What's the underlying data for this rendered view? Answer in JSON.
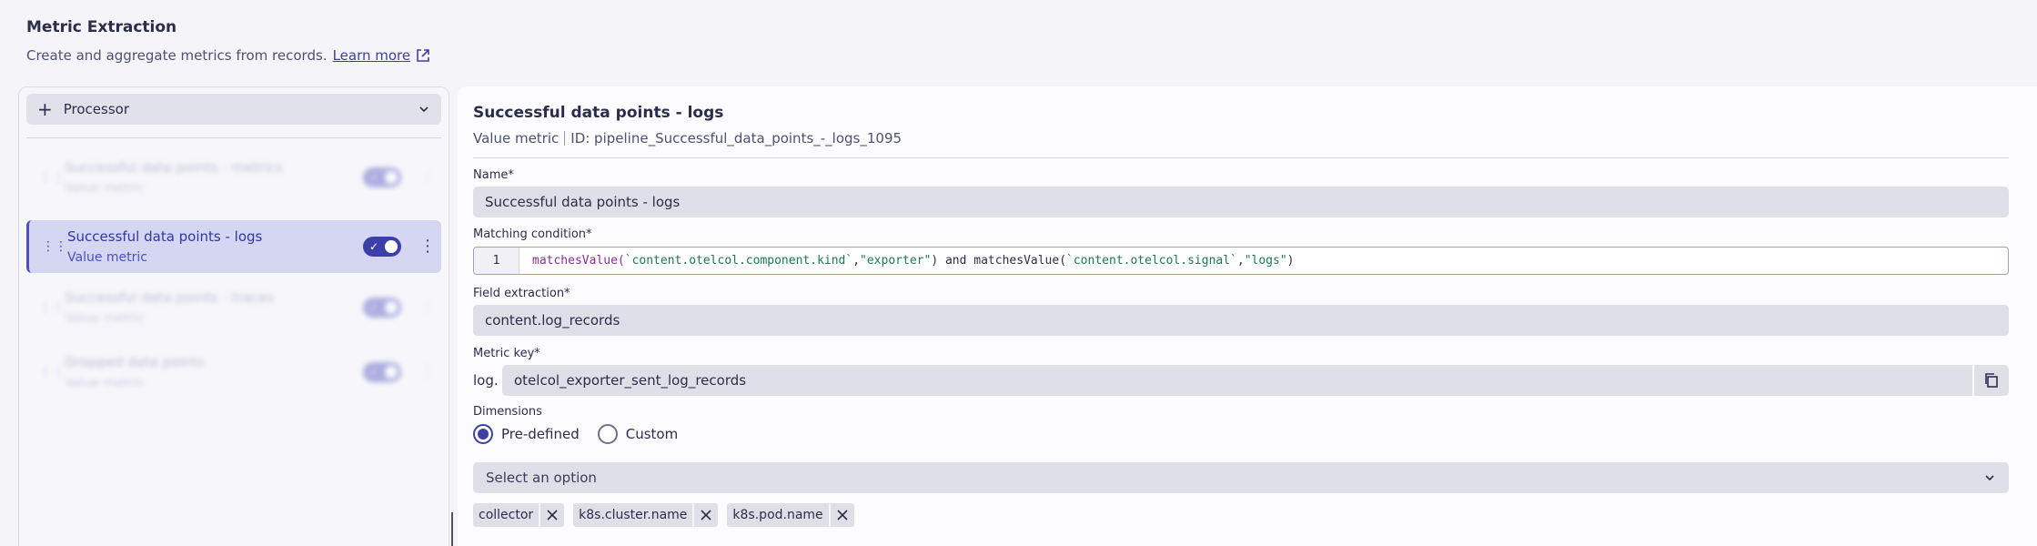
{
  "header": {
    "title": "Metric Extraction",
    "subtitle": "Create and aggregate metrics from records.",
    "learn_more": "Learn more"
  },
  "sidebar": {
    "processor_label": "Processor",
    "items": [
      {
        "name": "Successful data points - metrics",
        "type": "Value metric",
        "enabled": true,
        "active": false
      },
      {
        "name": "Successful data points - logs",
        "type": "Value metric",
        "enabled": true,
        "active": true
      },
      {
        "name": "Successful data points - traces",
        "type": "Value metric",
        "enabled": true,
        "active": false
      },
      {
        "name": "Dropped data points",
        "type": "Value metric",
        "enabled": true,
        "active": false
      }
    ]
  },
  "detail": {
    "title": "Successful data points - logs",
    "metric_type": "Value metric",
    "id_text": "ID: pipeline_Successful_data_points_-_logs_1095",
    "name_label": "Name*",
    "name_value": "Successful data points - logs",
    "condition_label": "Matching condition*",
    "condition_line_number": "1",
    "condition": {
      "fn1": "matchesValue(",
      "arg1": "`content.otelcol.component.kind`",
      "comma1": ",",
      "arg2": "\"exporter\"",
      "close1": ") and ",
      "fn2": "matchesValue(",
      "arg3": "`content.otelcol.signal`",
      "comma2": ",",
      "arg4": "\"logs\"",
      "close2": ")"
    },
    "field_extraction_label": "Field extraction*",
    "field_extraction_value": "content.log_records",
    "metric_key_label": "Metric key*",
    "metric_key_prefix": "log.",
    "metric_key_value": "otelcol_exporter_sent_log_records",
    "dimensions_label": "Dimensions",
    "dimension_options": [
      "Pre-defined",
      "Custom"
    ],
    "dimension_selected": "Pre-defined",
    "select_placeholder": "Select an option",
    "selected_dimensions": [
      "collector",
      "k8s.cluster.name",
      "k8s.pod.name"
    ]
  },
  "colors": {
    "accent": "#3d3fa8",
    "active_item_bg": "#d4d6f2",
    "field_bg": "#dfdfe8"
  }
}
